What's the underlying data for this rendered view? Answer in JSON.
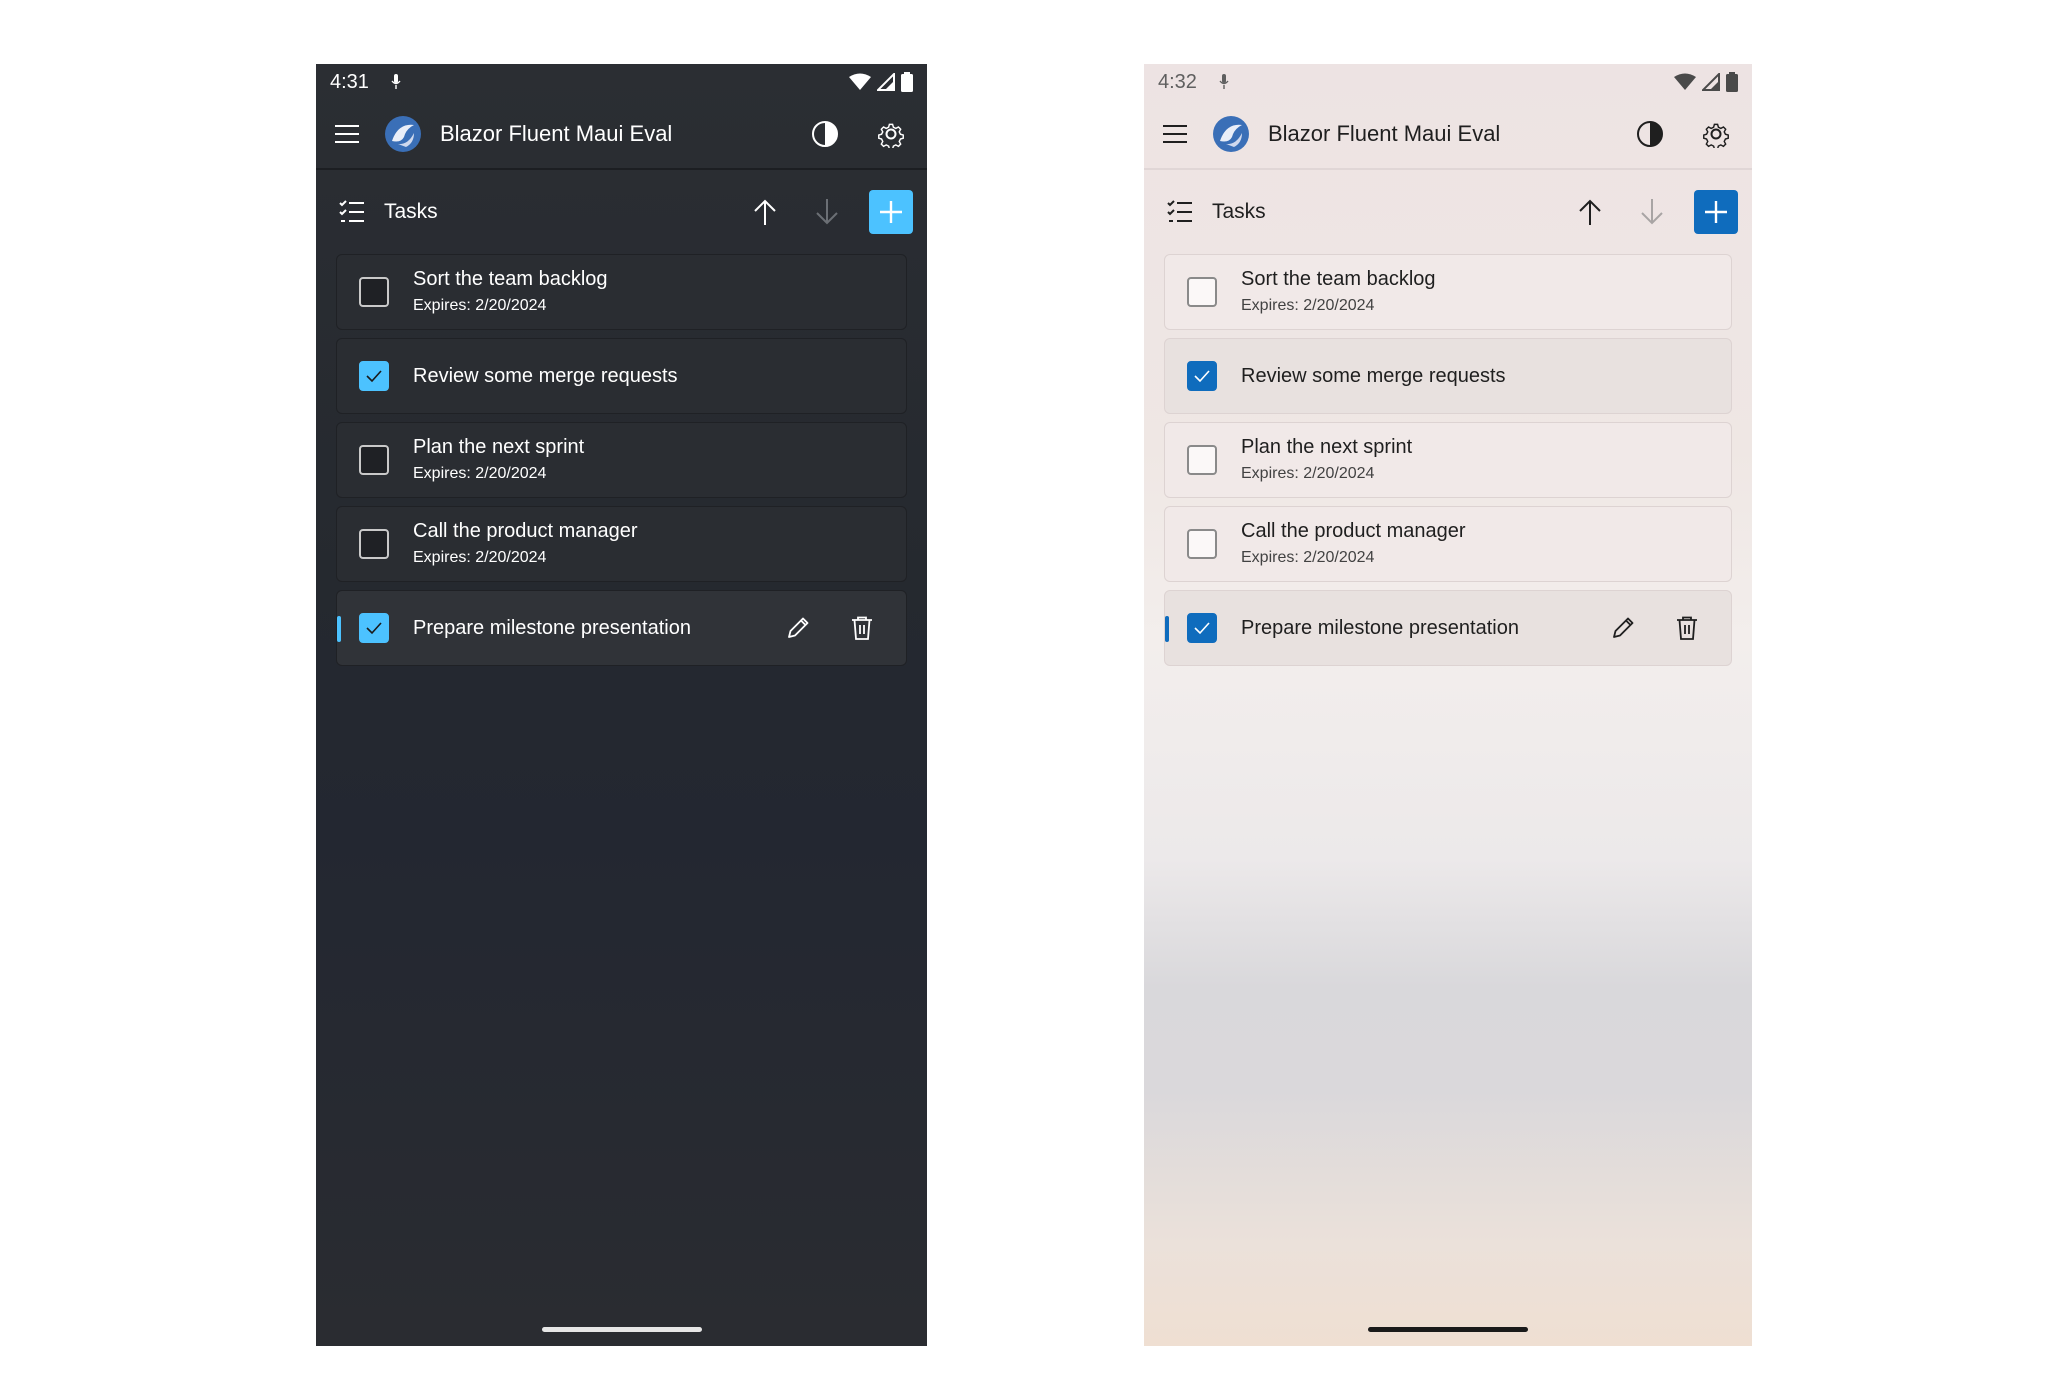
{
  "colors": {
    "dark_accent": "#4cc2ff",
    "light_accent": "#0f6cbd",
    "dark_background": "#2b2e33",
    "light_background": "#ede3e3"
  },
  "dark": {
    "status": {
      "time": "4:31"
    },
    "appbar": {
      "title": "Blazor Fluent Maui Eval"
    },
    "toolbar": {
      "label": "Tasks"
    },
    "tasks": [
      {
        "name": "Sort the team backlog",
        "expires": "Expires: 2/20/2024",
        "checked": false
      },
      {
        "name": "Review some merge requests",
        "expires": "",
        "checked": true
      },
      {
        "name": "Plan the next sprint",
        "expires": "Expires: 2/20/2024",
        "checked": false
      },
      {
        "name": "Call the product manager",
        "expires": "Expires: 2/20/2024",
        "checked": false
      },
      {
        "name": "Prepare milestone presentation",
        "expires": "",
        "checked": true,
        "selected": true
      }
    ]
  },
  "light": {
    "status": {
      "time": "4:32"
    },
    "appbar": {
      "title": "Blazor Fluent Maui Eval"
    },
    "toolbar": {
      "label": "Tasks"
    },
    "tasks": [
      {
        "name": "Sort the team backlog",
        "expires": "Expires: 2/20/2024",
        "checked": false
      },
      {
        "name": "Review some merge requests",
        "expires": "",
        "checked": true
      },
      {
        "name": "Plan the next sprint",
        "expires": "Expires: 2/20/2024",
        "checked": false
      },
      {
        "name": "Call the product manager",
        "expires": "Expires: 2/20/2024",
        "checked": false
      },
      {
        "name": "Prepare milestone presentation",
        "expires": "",
        "checked": true,
        "selected": true
      }
    ]
  },
  "icons": {
    "menu": "hamburger-menu-icon",
    "logo": "blazor-fluent-logo-icon",
    "theme": "contrast-theme-icon",
    "settings": "gear-icon",
    "list": "task-list-icon",
    "sort_up": "arrow-up-icon",
    "sort_down": "arrow-down-icon",
    "add": "plus-icon",
    "edit": "pencil-icon",
    "delete": "trash-icon",
    "check": "checkmark-icon"
  }
}
